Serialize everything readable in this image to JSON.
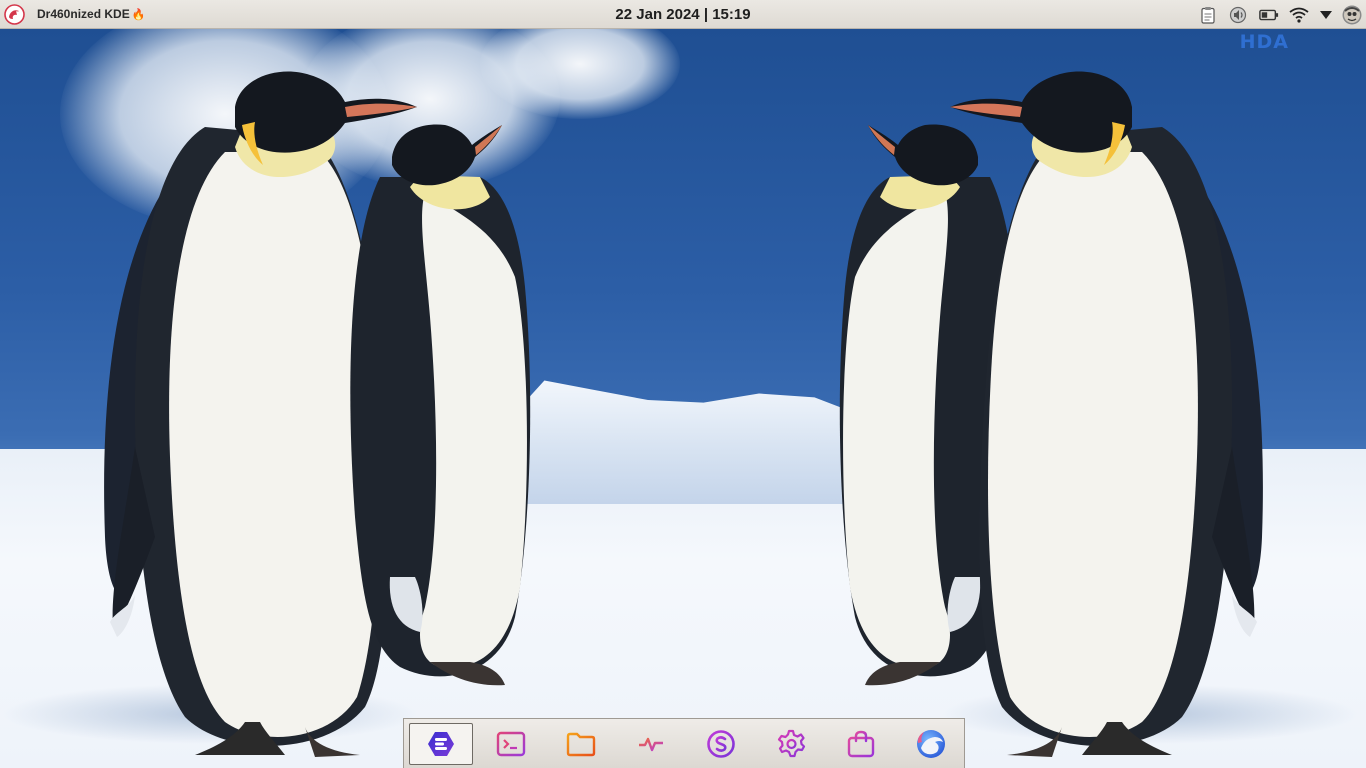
{
  "panel": {
    "menu_icon": "dragon-logo-icon",
    "app_title": "Dr460nized KDE",
    "flame_glyph": "🔥",
    "date": "22 Jan 2024",
    "separator": "|",
    "time": "15:19",
    "tray": [
      {
        "name": "clipboard-icon"
      },
      {
        "name": "audio-icon"
      },
      {
        "name": "battery-icon"
      },
      {
        "name": "wifi-icon"
      },
      {
        "name": "expand-tray-icon"
      },
      {
        "name": "user-avatar-icon"
      }
    ]
  },
  "desktop": {
    "watermark": "HDA"
  },
  "dock": {
    "items": [
      {
        "name": "app-launcher-icon",
        "color": "#5b3cd6"
      },
      {
        "name": "terminal-icon",
        "color": "#b33bd9"
      },
      {
        "name": "file-manager-icon",
        "color": "#f07a1a"
      },
      {
        "name": "system-monitor-icon",
        "color": "#d93a8e"
      },
      {
        "name": "software-center-icon",
        "color": "#9b35d8"
      },
      {
        "name": "settings-icon",
        "color": "#b02bd8"
      },
      {
        "name": "store-bag-icon",
        "color": "#c43bd9"
      },
      {
        "name": "browser-icon",
        "color": "#3a7de0"
      }
    ]
  },
  "colors": {
    "panel_bg": "#e4e1dc",
    "accent_purple": "#8a34d8",
    "accent_orange": "#f07a1a"
  }
}
